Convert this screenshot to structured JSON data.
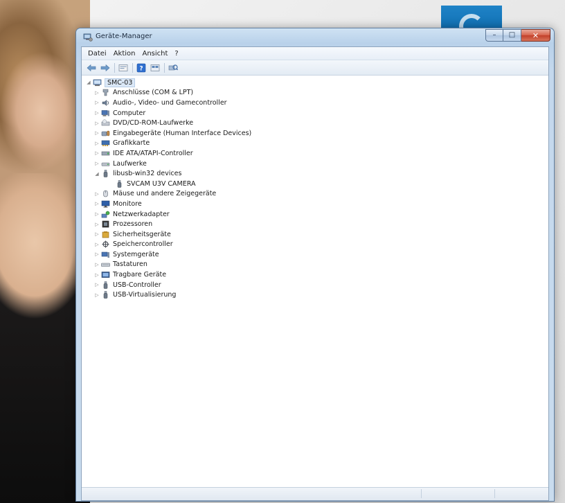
{
  "window": {
    "title": "Geräte-Manager",
    "controls": {
      "minimize": "–",
      "maximize": "□",
      "close": "✕"
    }
  },
  "menu": [
    {
      "label": "Datei"
    },
    {
      "label": "Aktion"
    },
    {
      "label": "Ansicht"
    },
    {
      "label": "?"
    }
  ],
  "toolbar": {
    "icons": [
      "back-icon",
      "forward-icon",
      "properties-view-icon",
      "help-icon",
      "device-view-icon",
      "scan-hardware-icon"
    ]
  },
  "tree": {
    "root": "SMC-03",
    "categories": [
      {
        "label": "Anschlüsse (COM & LPT)",
        "icon": "port-icon"
      },
      {
        "label": "Audio-, Video- und Gamecontroller",
        "icon": "speaker-icon"
      },
      {
        "label": "Computer",
        "icon": "computer-icon"
      },
      {
        "label": "DVD/CD-ROM-Laufwerke",
        "icon": "dvd-drive-icon"
      },
      {
        "label": "Eingabegeräte (Human Interface Devices)",
        "icon": "hid-icon"
      },
      {
        "label": "Grafikkarte",
        "icon": "display-adapter-icon"
      },
      {
        "label": "IDE ATA/ATAPI-Controller",
        "icon": "ide-controller-icon"
      },
      {
        "label": "Laufwerke",
        "icon": "disk-drive-icon"
      },
      {
        "label": "libusb-win32 devices",
        "icon": "usb-device-icon",
        "expanded": true,
        "children": [
          {
            "label": "SVCAM U3V CAMERA",
            "icon": "usb-device-icon"
          }
        ]
      },
      {
        "label": "Mäuse und andere Zeigegeräte",
        "icon": "mouse-icon"
      },
      {
        "label": "Monitore",
        "icon": "monitor-icon"
      },
      {
        "label": "Netzwerkadapter",
        "icon": "network-adapter-icon"
      },
      {
        "label": "Prozessoren",
        "icon": "processor-icon"
      },
      {
        "label": "Sicherheitsgeräte",
        "icon": "security-device-icon"
      },
      {
        "label": "Speichercontroller",
        "icon": "storage-controller-icon"
      },
      {
        "label": "Systemgeräte",
        "icon": "system-device-icon"
      },
      {
        "label": "Tastaturen",
        "icon": "keyboard-icon"
      },
      {
        "label": "Tragbare Geräte",
        "icon": "portable-device-icon"
      },
      {
        "label": "USB-Controller",
        "icon": "usb-icon"
      },
      {
        "label": "USB-Virtualisierung",
        "icon": "usb-icon"
      }
    ]
  },
  "colors": {
    "titlebar": "#b9d1ea",
    "selection": "#dbe8f7",
    "close_button": "#c2402a",
    "desktop_logo": "#1f83c7"
  }
}
